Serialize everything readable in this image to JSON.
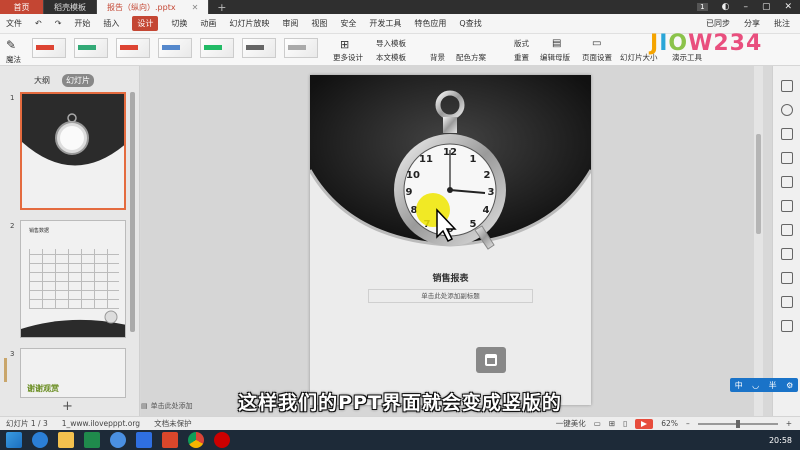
{
  "tabs": {
    "home": "首页",
    "templates": "稻壳模板",
    "doc": "报告（纵向）.pptx",
    "add": "+"
  },
  "window": {
    "badge": "1"
  },
  "menu": {
    "file": "文件",
    "items": [
      "开始",
      "插入",
      "设计",
      "切换",
      "动画",
      "幻灯片放映",
      "审阅",
      "视图",
      "安全",
      "开发工具",
      "特色应用"
    ],
    "search": "Q查找",
    "sync": "已同步",
    "share": "分享",
    "annotate": "批注"
  },
  "ribbon": {
    "magic": "魔法",
    "more_design": "更多设计",
    "import_template": "导入模板",
    "this_template": "本文模板",
    "layout": "版式",
    "background": "背景",
    "color_scheme": "配色方案",
    "reset": "重置",
    "edit_master": "编辑母版",
    "page_setup": "页面设置",
    "slide_size": "幻灯片大小",
    "presenter_tools": "演示工具",
    "logo": [
      "J",
      "I",
      "O",
      "W234"
    ]
  },
  "left_panel": {
    "outline_tab": "大纲",
    "slides_tab": "幻灯片",
    "slide_numbers": [
      "1",
      "2",
      "3"
    ],
    "thumb2_title": "销售数据",
    "thumb3_title": "谢谢观赏",
    "add_slide": "+"
  },
  "slide": {
    "title": "销售报表",
    "subtitle_placeholder": "单击此处添加副标题"
  },
  "notes": "单击此处添加",
  "status": {
    "slide_count": "幻灯片 1 / 3",
    "theme": "1_www.ilovepppt.org",
    "protect": "文档未保护",
    "beautify": "一键美化",
    "zoom": "62%"
  },
  "ime": {
    "cn": "中",
    "half": "半"
  },
  "subtitle_caption": "这样我们的PPT界面就会变成竖版的",
  "clock": "20:58",
  "colors": {
    "accent": "#c44633",
    "selected_border": "#e46b3f",
    "taskbar": "#1d2a38"
  }
}
